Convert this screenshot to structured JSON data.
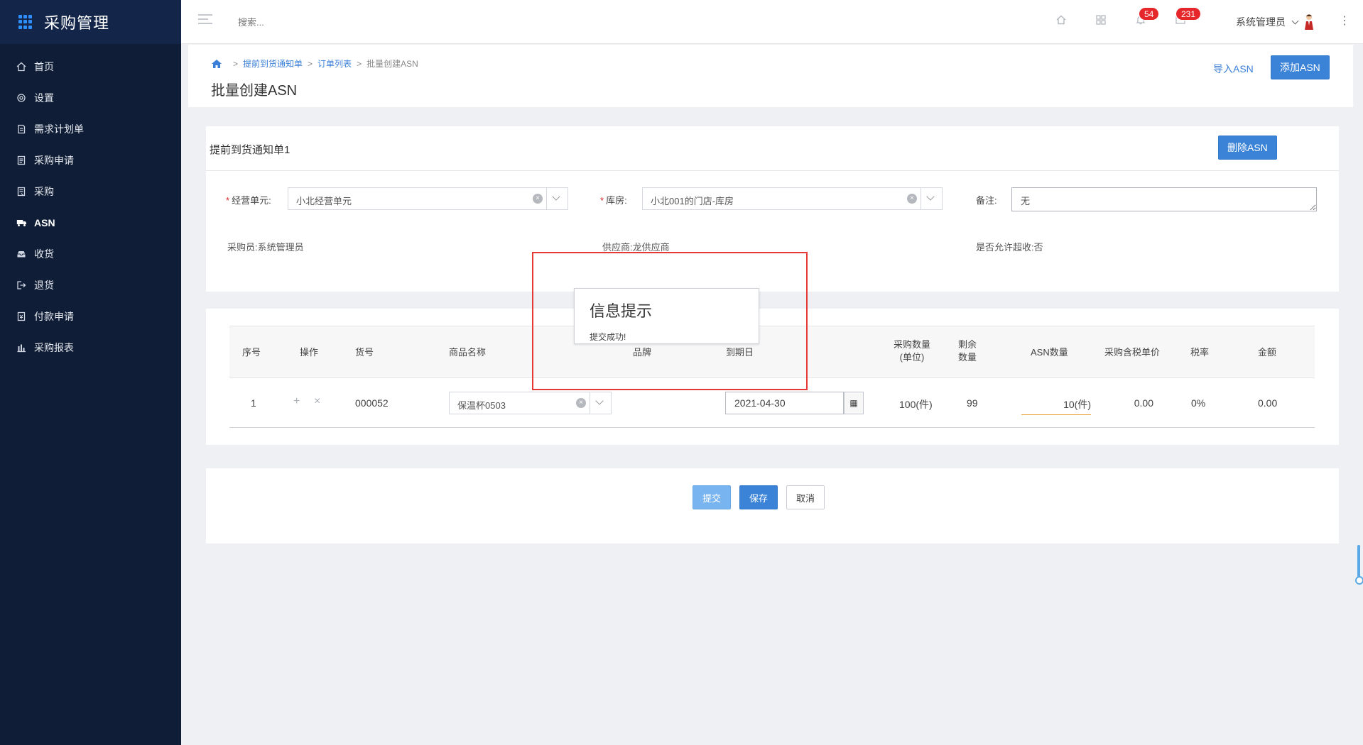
{
  "app": {
    "title": "采购管理"
  },
  "sidebar": {
    "items": [
      {
        "label": "首页",
        "icon": "home-icon"
      },
      {
        "label": "设置",
        "icon": "gear-icon"
      },
      {
        "label": "需求计划单",
        "icon": "document-icon"
      },
      {
        "label": "采购申请",
        "icon": "form-icon"
      },
      {
        "label": "采购",
        "icon": "list-icon"
      },
      {
        "label": "ASN",
        "icon": "truck-icon"
      },
      {
        "label": "收货",
        "icon": "inbox-icon"
      },
      {
        "label": "退货",
        "icon": "return-icon"
      },
      {
        "label": "付款申请",
        "icon": "payment-icon"
      },
      {
        "label": "采购报表",
        "icon": "bar-chart-icon"
      }
    ]
  },
  "header": {
    "search_placeholder": "搜索...",
    "notifications_count": "54",
    "messages_count": "231",
    "user_name": "系统管理员"
  },
  "page": {
    "breadcrumb": [
      "提前到货通知单",
      "订单列表",
      "批量创建ASN"
    ],
    "title": "批量创建ASN",
    "import_label": "导入ASN",
    "add_label": "添加ASN"
  },
  "asn_card": {
    "title": "提前到货通知单1",
    "delete_label": "删除ASN",
    "business_unit_label": "经营单元:",
    "business_unit_value": "小北经营单元",
    "warehouse_label": "库房:",
    "warehouse_value": "小北001的门店-库房",
    "remark_label": "备注:",
    "remark_value": "无",
    "buyer_label": "采购员:",
    "buyer_value": "系统管理员",
    "supplier_label": "供应商:",
    "supplier_value": "龙供应商",
    "overdelivery_label": "是否允许超收:",
    "overdelivery_value": "否"
  },
  "table": {
    "headers": {
      "index": "序号",
      "action": "操作",
      "sku": "货号",
      "product": "商品名称",
      "brand": "品牌",
      "due_date": "到期日",
      "purchase_qty_1": "采购数量",
      "purchase_qty_2": "(单位)",
      "remaining_1": "剩余",
      "remaining_2": "数量",
      "asn_qty": "ASN数量",
      "unit_price": "采购含税单价",
      "tax_rate": "税率",
      "amount": "金额"
    },
    "rows": [
      {
        "index": "1",
        "sku": "000052",
        "product": "保温杯0503",
        "brand": "",
        "due_date": "2021-04-30",
        "purchase_qty": "100(件)",
        "remaining": "99",
        "asn_qty": "10(件)",
        "unit_price": "0.00",
        "tax_rate": "0%",
        "amount": "0.00"
      }
    ]
  },
  "footer_actions": {
    "submit_label": "提交",
    "save_label": "保存",
    "cancel_label": "取消"
  },
  "dialog": {
    "title": "信息提示",
    "message": "提交成功!"
  },
  "colors": {
    "sidebar_bg": "#0f1d36",
    "primary": "#3a83d6",
    "badge": "#e5262b",
    "highlight_border": "#e53935"
  }
}
